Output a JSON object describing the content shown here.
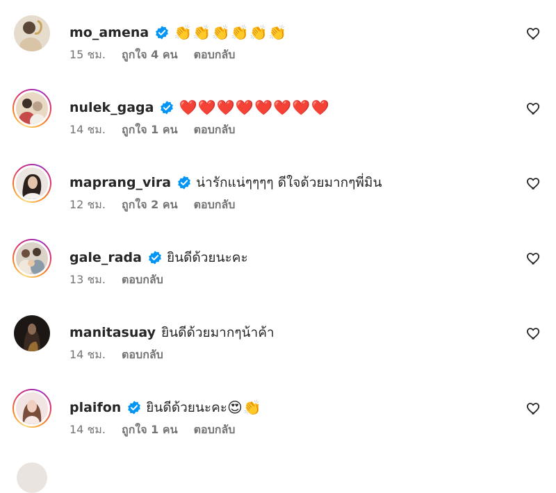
{
  "comments": [
    {
      "username": "mo_amena",
      "verified": true,
      "text": "",
      "emoji": "👏👏👏👏👏👏",
      "time": "15 ชม.",
      "likes": "ถูกใจ 4 คน",
      "reply": "ตอบกลับ"
    },
    {
      "username": "nulek_gaga",
      "verified": true,
      "text": "",
      "emoji": "❤️❤️❤️❤️❤️❤️❤️❤️",
      "time": "14 ชม.",
      "likes": "ถูกใจ 1 คน",
      "reply": "ตอบกลับ"
    },
    {
      "username": "maprang_vira",
      "verified": true,
      "text": "น่ารักแน่ๆๆๆๆ ดีใจด้วยมากๆพี่มิน",
      "emoji": "",
      "time": "12 ชม.",
      "likes": "ถูกใจ 2 คน",
      "reply": "ตอบกลับ"
    },
    {
      "username": "gale_rada",
      "verified": true,
      "text": "ยินดีด้วยนะคะ",
      "emoji": "",
      "time": "13 ชม.",
      "likes": "",
      "reply": "ตอบกลับ"
    },
    {
      "username": "manitasuay",
      "verified": false,
      "text": "ยินดีด้วยมากๆน้าค้า",
      "emoji": "",
      "time": "14 ชม.",
      "likes": "",
      "reply": "ตอบกลับ"
    },
    {
      "username": "plaifon",
      "verified": true,
      "text": "ยินดีด้วยนะคะ",
      "emoji": "😍👏",
      "time": "14 ชม.",
      "likes": "ถูกใจ 1 คน",
      "reply": "ตอบกลับ"
    }
  ],
  "colors": {
    "verified_badge": "#0095f6",
    "secondary_text": "#737373",
    "primary_text": "#262626"
  },
  "icons": {
    "like": "heart-outline-icon",
    "verified": "verified-badge-icon"
  }
}
